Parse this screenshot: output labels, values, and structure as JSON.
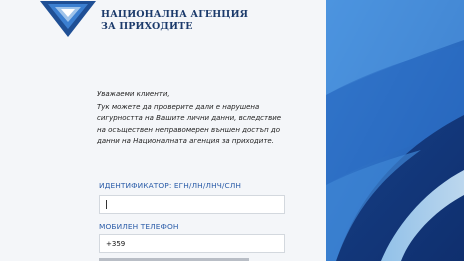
{
  "brand": {
    "line1": "НАЦИОНАЛНА АГЕНЦИЯ",
    "line2": "ЗА ПРИХОДИТЕ"
  },
  "intro": {
    "greeting": "Уважаеми клиенти,",
    "lines": [
      "Тук можете да проверите дали е нарушена",
      "сигурността на Вашите лични данни, вследствие",
      "на осъществен неправомерен външен достъп до",
      "данни на Националната агенция за приходите."
    ]
  },
  "form": {
    "id_label": "ИДЕНТИФИКАТОР: ЕГН/ЛН/ЛНЧ/СЛН",
    "id_value": "",
    "phone_label": "МОБИЛЕН ТЕЛЕФОН",
    "phone_value": "+359"
  },
  "colors": {
    "brand_blue": "#1b3a6b",
    "label_blue": "#2a5ca8",
    "panel_blue": "#2f73c9"
  }
}
